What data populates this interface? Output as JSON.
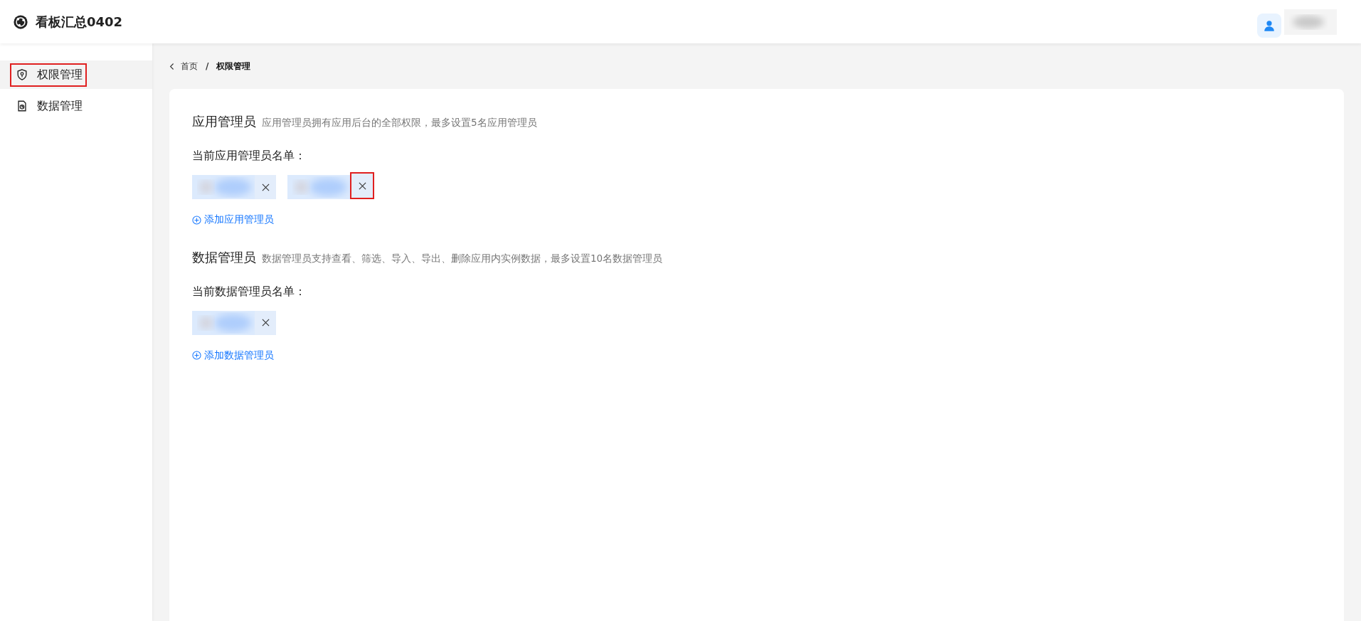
{
  "header": {
    "title": "看板汇总0402"
  },
  "sidebar": {
    "items": [
      {
        "label": "权限管理",
        "selected": true,
        "highlighted": true
      },
      {
        "label": "数据管理",
        "selected": false,
        "highlighted": false
      }
    ]
  },
  "breadcrumb": {
    "items": [
      "首页",
      "权限管理"
    ],
    "separator": "/"
  },
  "sections": [
    {
      "title": "应用管理员",
      "description": "应用管理员拥有应用后台的全部权限，最多设置5名应用管理员",
      "list_label": "当前应用管理员名单：",
      "members": [
        {
          "highlighted": false
        },
        {
          "highlighted": true
        }
      ],
      "add_link": "添加应用管理员"
    },
    {
      "title": "数据管理员",
      "description": "数据管理员支持查看、筛选、导入、导出、删除应用内实例数据，最多设置10名数据管理员",
      "list_label": "当前数据管理员名单：",
      "members": [
        {
          "highlighted": false
        }
      ],
      "add_link": "添加数据管理员"
    }
  ]
}
